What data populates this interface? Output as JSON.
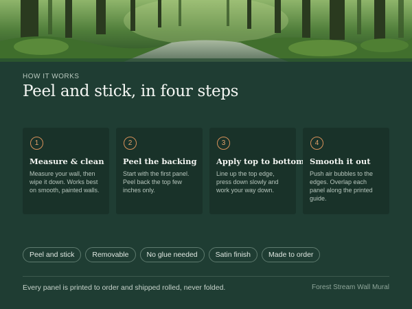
{
  "section": {
    "eyebrow": "HOW IT WORKS",
    "title": "Peel and stick, in four steps"
  },
  "steps": [
    {
      "number": "1",
      "title": "Measure & clean",
      "description": "Measure your wall, then wipe it down. Works best on smooth, painted walls."
    },
    {
      "number": "2",
      "title": "Peel the backing",
      "description": "Start with the first panel. Peel back the top few inches only."
    },
    {
      "number": "3",
      "title": "Apply top to bottom",
      "description": "Line up the top edge, press down slowly and work your way down."
    },
    {
      "number": "4",
      "title": "Smooth it out",
      "description": "Push air bubbles to the edges. Overlap each panel along the printed guide."
    }
  ],
  "tags": [
    "Peel and stick",
    "Removable",
    "No glue needed",
    "Satin finish",
    "Made to order"
  ],
  "footer": {
    "note": "Every panel is printed to order and shipped rolled, never folded.",
    "product": "Forest Stream Wall Mural"
  },
  "colors": {
    "background": "#1f3d33",
    "card": "#193229",
    "accent": "#e6a56d"
  },
  "hero_image": "forest-stream-photo"
}
